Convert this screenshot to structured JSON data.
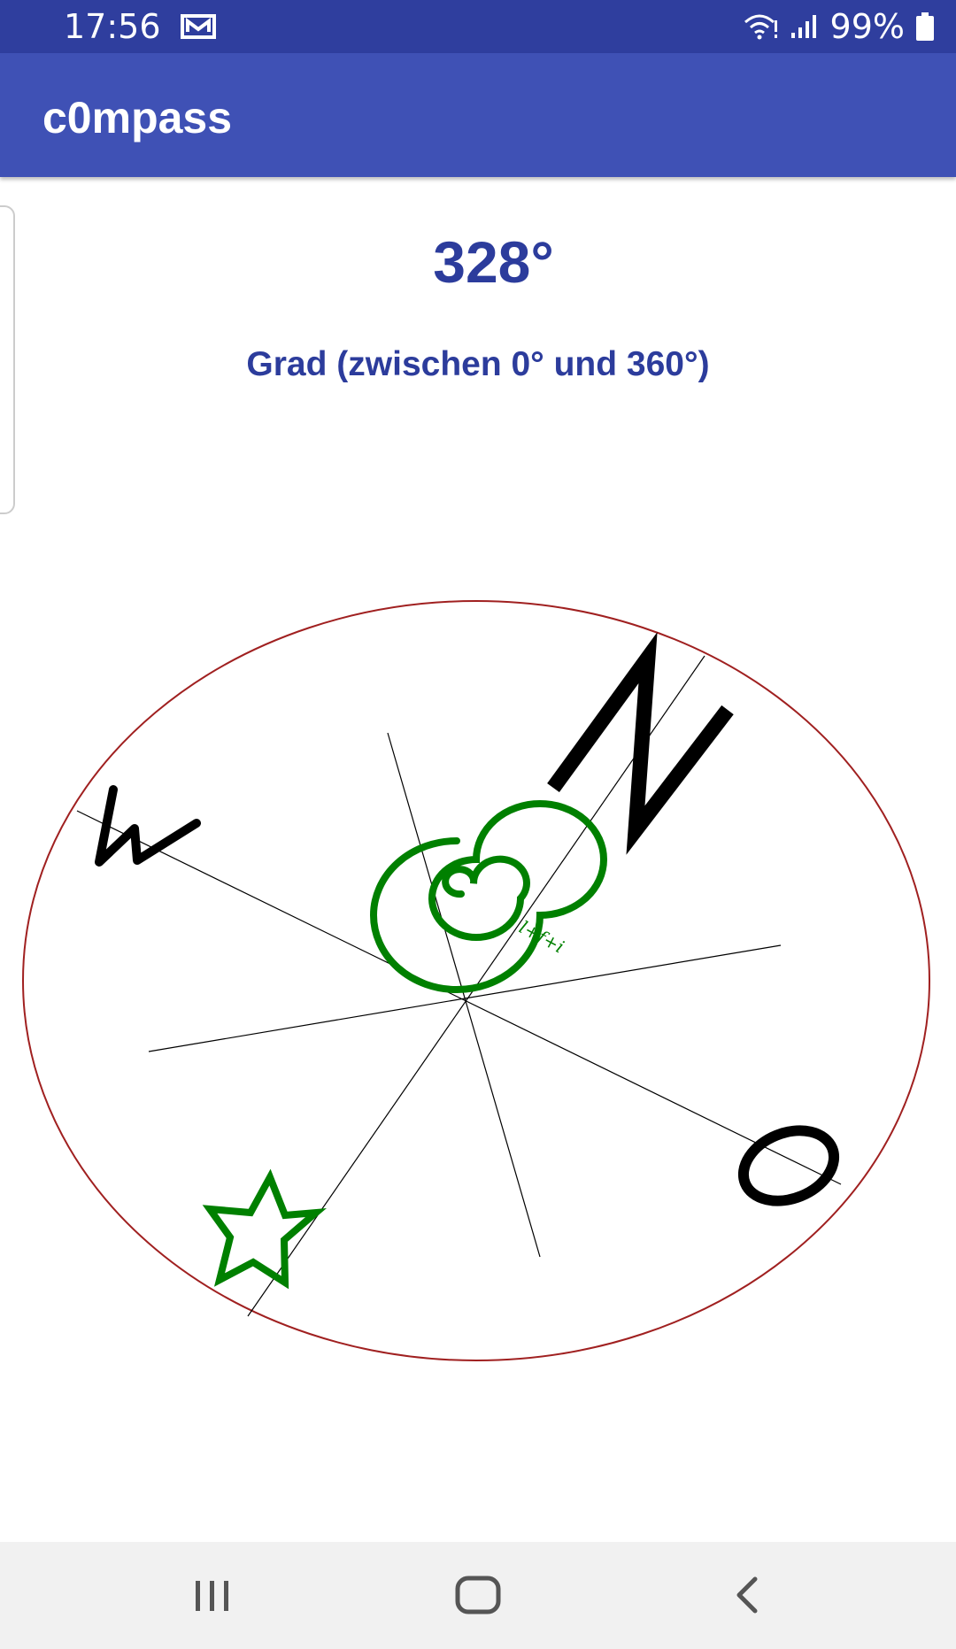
{
  "status": {
    "time": "17:56",
    "battery": "99%"
  },
  "app": {
    "title": "c0mpass"
  },
  "compass": {
    "heading": "328°",
    "unit_label": "Grad (zwischen 0° und 360°)",
    "cardinal": {
      "north": "N",
      "west": "W",
      "east": "O"
    },
    "center_mark": "l+f+i",
    "colors": {
      "ring": "#a02020",
      "lines": "#000000",
      "spiral": "#008000",
      "star": "#008000",
      "letters": "#000000"
    }
  },
  "nav": {
    "recents": "recents-icon",
    "home": "home-icon",
    "back": "back-icon"
  }
}
